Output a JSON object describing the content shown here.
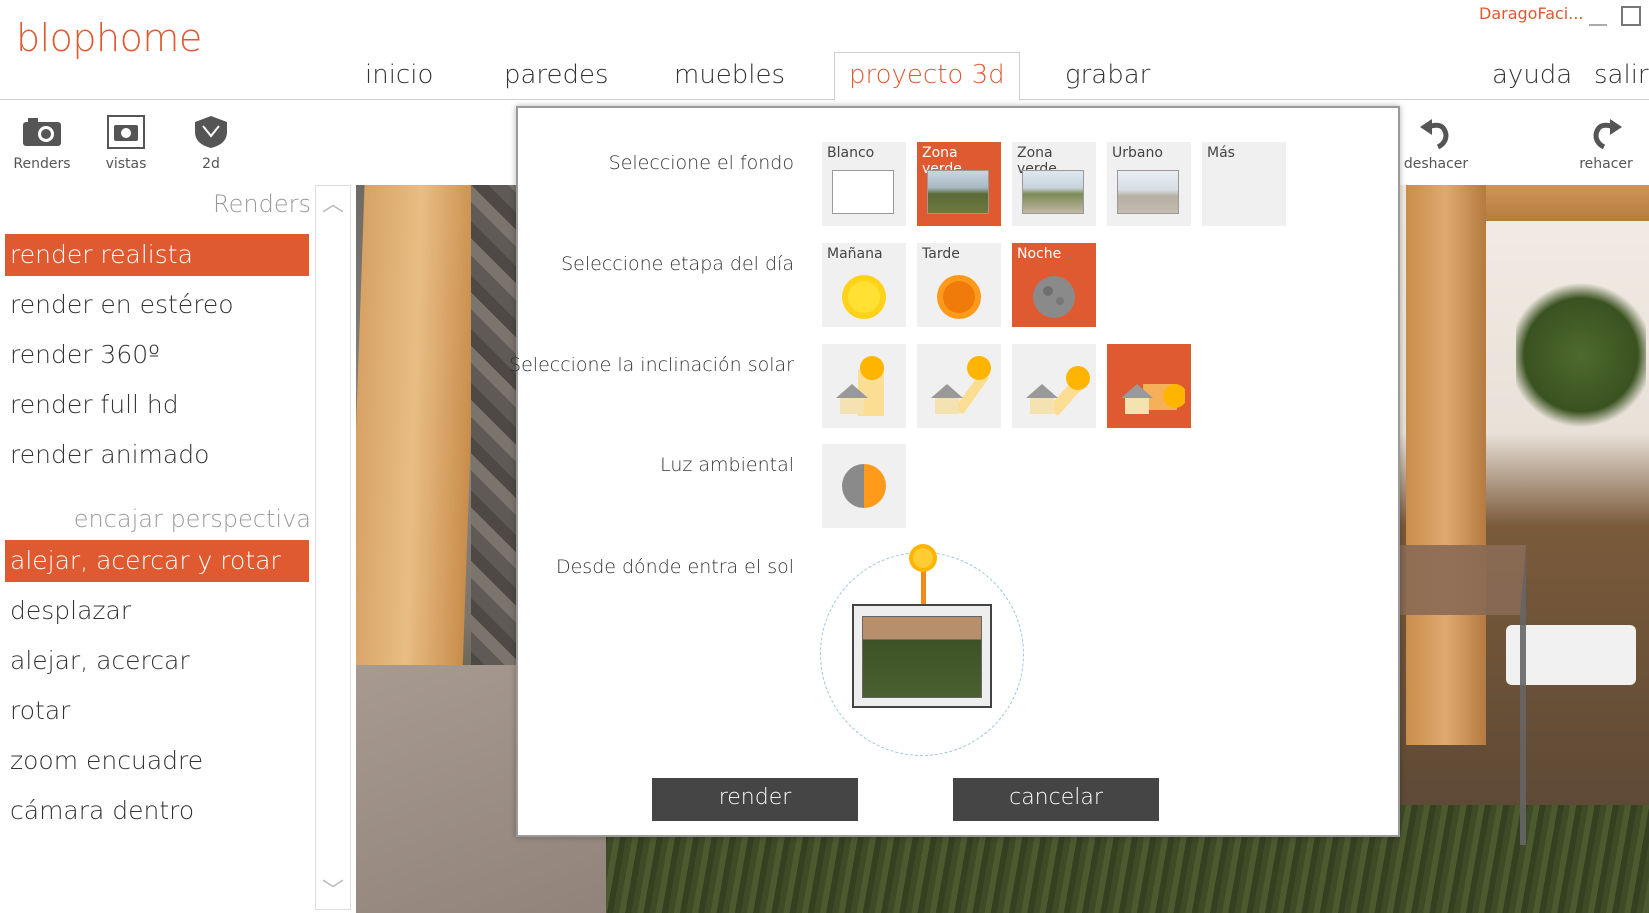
{
  "app": {
    "logo": "blophome",
    "user": "DaragoFaci..."
  },
  "nav": [
    "inicio",
    "paredes",
    "muebles",
    "proyecto 3d",
    "grabar",
    "ayuda",
    "salir"
  ],
  "toolbar": {
    "renders": "Renders",
    "vistas": "vistas",
    "twod": "2d",
    "undo": "deshacer",
    "redo": "rehacer"
  },
  "sidebar": {
    "renders_title": "Renders",
    "renders": [
      "render realista",
      "render en estéreo",
      "render 360º",
      "render full hd",
      "render animado"
    ],
    "perspective_title": "encajar perspectiva",
    "perspective": [
      "alejar, acercar y rotar",
      "desplazar",
      "alejar, acercar",
      "rotar",
      "zoom encuadre",
      "cámara dentro"
    ]
  },
  "dialog": {
    "fondo_label": "Seleccione el fondo",
    "fondo_options": [
      "Blanco",
      "Zona verde",
      "Zona verde",
      "Urbano",
      "Más"
    ],
    "fondo_selected": 1,
    "etapa_label": "Seleccione etapa del día",
    "etapa_options": [
      "Mañana",
      "Tarde",
      "Noche"
    ],
    "etapa_selected": 2,
    "inclinacion_label": "Seleccione la inclinación solar",
    "inclinacion_selected": 3,
    "luz_label": "Luz ambiental",
    "sol_label": "Desde dónde entra el sol",
    "render_button": "render",
    "cancel_button": "cancelar"
  },
  "colors": {
    "accent": "#e05a31",
    "button": "#454545"
  }
}
